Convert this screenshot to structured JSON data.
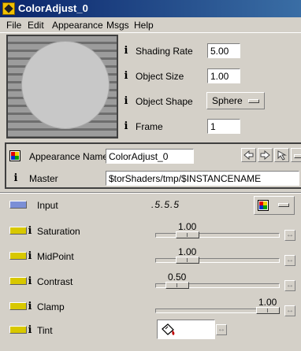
{
  "window": {
    "title": "ColorAdjust_0"
  },
  "menu": [
    {
      "label": "File"
    },
    {
      "label": "Edit"
    },
    {
      "label": "Appearance"
    },
    {
      "label": "Msgs"
    },
    {
      "label": "Help"
    }
  ],
  "preview_params": [
    {
      "label": "Shading Rate",
      "value": "5.00"
    },
    {
      "label": "Object Size",
      "value": "1.00"
    },
    {
      "label": "Object Shape",
      "value": "Sphere"
    },
    {
      "label": "Frame",
      "value": "1"
    }
  ],
  "info_glyph": "i",
  "appearance": {
    "name_label": "Appearance Name",
    "name_value": "ColorAdjust_0",
    "master_label": "Master",
    "master_value": "$torShaders/tmp/$INSTANCENAME"
  },
  "input_row": {
    "label": "Input",
    "value": ".5.5.5"
  },
  "params": [
    {
      "label": "Saturation",
      "value": "1.00",
      "level": 0.2
    },
    {
      "label": "MidPoint",
      "value": "1.00",
      "level": 0.2
    },
    {
      "label": "Contrast",
      "value": "0.50",
      "level": 0.1
    },
    {
      "label": "Clamp",
      "value": "1.00",
      "level": 1.0
    },
    {
      "label": "Tint"
    }
  ],
  "colors": {
    "titlebar_start": "#0a246a",
    "titlebar_end": "#3a6ea5",
    "input_led": "#7b8fd6",
    "param_led": "#d8c800",
    "window_bg": "#d4d0c8"
  },
  "icons": [
    "app-icon",
    "appearance-logo-icon",
    "info-icon",
    "arrow-left-icon",
    "arrow-right-icon",
    "pointer-icon",
    "link-icon",
    "paint-bucket-icon",
    "option-menu-bar-icon"
  ]
}
